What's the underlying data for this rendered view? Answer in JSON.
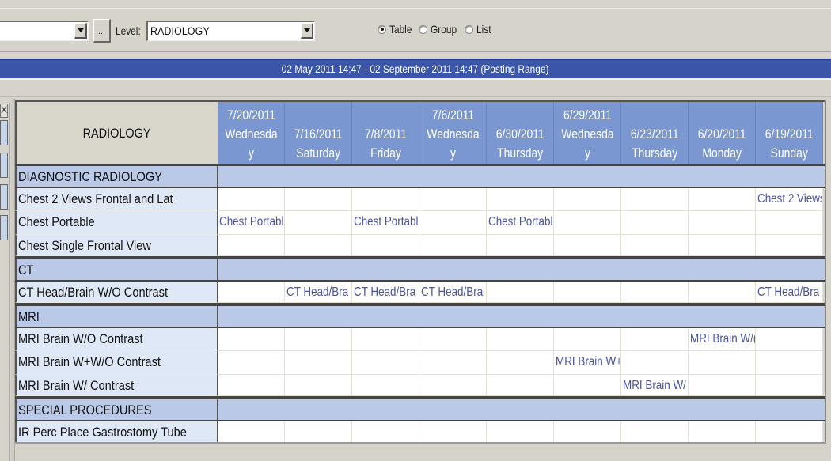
{
  "toolbar": {
    "first_combo_value": "",
    "ellipsis_label": "...",
    "level_label": "Level:",
    "level_value": "RADIOLOGY",
    "view_options": [
      {
        "label": "Table",
        "selected": true
      },
      {
        "label": "Group",
        "selected": false
      },
      {
        "label": "List",
        "selected": false
      }
    ]
  },
  "range_bar": {
    "text": "02 May 2011 14:47 - 02 September 2011 14:47 (Posting Range)",
    "color": "#3b55a8"
  },
  "left_panel": {
    "close_label": "X"
  },
  "grid": {
    "corner_header": "RADIOLOGY",
    "columns": [
      {
        "date": "7/20/2011",
        "day": "Wednesda\ny"
      },
      {
        "date": "7/16/2011",
        "day": "Saturday"
      },
      {
        "date": "7/8/2011",
        "day": "Friday"
      },
      {
        "date": "7/6/2011",
        "day": "Wednesda\ny"
      },
      {
        "date": "6/30/2011",
        "day": "Thursday"
      },
      {
        "date": "6/29/2011",
        "day": "Wednesda\ny"
      },
      {
        "date": "6/23/2011",
        "day": "Thursday"
      },
      {
        "date": "6/20/2011",
        "day": "Monday"
      },
      {
        "date": "6/19/2011",
        "day": "Sunday"
      }
    ],
    "rows": [
      {
        "type": "section",
        "label": "DIAGNOSTIC RADIOLOGY"
      },
      {
        "type": "item",
        "label": "Chest 2 Views Frontal and Lat",
        "cells": [
          "",
          "",
          "",
          "",
          "",
          "",
          "",
          "",
          "Chest 2 Views"
        ]
      },
      {
        "type": "item",
        "label": "Chest Portable",
        "cells": [
          "Chest Portabl",
          "",
          "Chest Portabl",
          "",
          "Chest Portabl",
          "",
          "",
          "",
          ""
        ]
      },
      {
        "type": "item",
        "label": "Chest Single Frontal View",
        "cells": [
          "",
          "",
          "",
          "",
          "",
          "",
          "",
          "",
          ""
        ]
      },
      {
        "type": "section",
        "label": "CT"
      },
      {
        "type": "item",
        "label": "CT Head/Brain W/O Contrast",
        "cells": [
          "",
          "CT Head/Bra",
          "CT Head/Bra",
          "CT Head/Bra",
          "",
          "",
          "",
          "",
          "CT Head/Bra"
        ]
      },
      {
        "type": "section",
        "label": "MRI"
      },
      {
        "type": "item",
        "label": "MRI Brain W/O Contrast",
        "cells": [
          "",
          "",
          "",
          "",
          "",
          "",
          "",
          "MRI Brain W/(",
          ""
        ]
      },
      {
        "type": "item",
        "label": "MRI Brain W+W/O Contrast",
        "cells": [
          "",
          "",
          "",
          "",
          "",
          "MRI Brain W+",
          "",
          "",
          ""
        ]
      },
      {
        "type": "item",
        "label": "MRI Brain W/ Contrast",
        "cells": [
          "",
          "",
          "",
          "",
          "",
          "",
          "MRI Brain W/",
          "",
          ""
        ]
      },
      {
        "type": "section",
        "label": "SPECIAL PROCEDURES"
      },
      {
        "type": "item",
        "label": "IR Perc Place Gastrostomy Tube",
        "cells": [
          "",
          "",
          "",
          "",
          "",
          "",
          "",
          "",
          ""
        ]
      }
    ]
  },
  "colors": {
    "header_date_bg": "#7b97d2",
    "section_bg": "#b9c9e7",
    "item_label_bg": "#dfe8f6",
    "cell_text": "#4b52a0"
  }
}
